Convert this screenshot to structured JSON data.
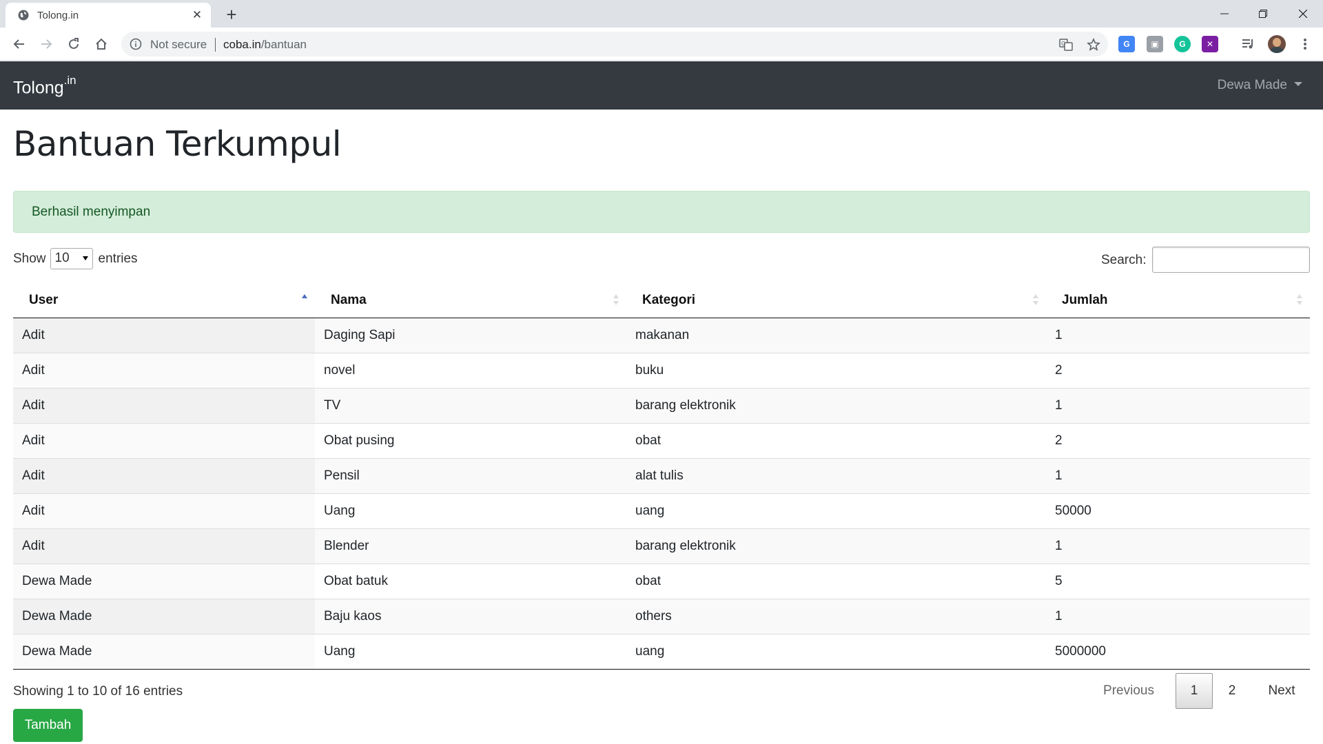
{
  "browser": {
    "tab_title": "Tolong.in",
    "address_security": "Not secure",
    "address_host": "coba.in",
    "address_path": "/bantuan"
  },
  "navbar": {
    "brand": "Tolong",
    "brand_sup": ".in",
    "user_name": "Dewa Made"
  },
  "page": {
    "title": "Bantuan Terkumpul",
    "alert": "Berhasil menyimpan"
  },
  "datatable": {
    "show_label": "Show",
    "entries_label": "entries",
    "page_length": "10",
    "search_label": "Search:",
    "search_value": "",
    "columns": [
      "User",
      "Nama",
      "Kategori",
      "Jumlah"
    ],
    "sorted_column": "User",
    "sort_direction": "ascending",
    "rows": [
      [
        "Adit",
        "Daging Sapi",
        "makanan",
        "1"
      ],
      [
        "Adit",
        "novel",
        "buku",
        "2"
      ],
      [
        "Adit",
        "TV",
        "barang elektronik",
        "1"
      ],
      [
        "Adit",
        "Obat pusing",
        "obat",
        "2"
      ],
      [
        "Adit",
        "Pensil",
        "alat tulis",
        "1"
      ],
      [
        "Adit",
        "Uang",
        "uang",
        "50000"
      ],
      [
        "Adit",
        "Blender",
        "barang elektronik",
        "1"
      ],
      [
        "Dewa Made",
        "Obat batuk",
        "obat",
        "5"
      ],
      [
        "Dewa Made",
        "Baju kaos",
        "others",
        "1"
      ],
      [
        "Dewa Made",
        "Uang",
        "uang",
        "5000000"
      ]
    ],
    "info": "Showing 1 to 10 of 16 entries",
    "pagination": {
      "previous": "Previous",
      "pages": [
        "1",
        "2"
      ],
      "current_page": "1",
      "next": "Next"
    }
  },
  "actions": {
    "add_label": "Tambah"
  },
  "colors": {
    "navbar_bg": "#343a40",
    "alert_bg": "#d4edda",
    "alert_text": "#155724",
    "button_success": "#28a745",
    "sort_active": "#4b6cc1"
  },
  "icons": {
    "tab_favicon": "globe-icon",
    "tab_close": "close-icon",
    "new_tab": "plus-icon",
    "back": "arrow-left-icon",
    "forward": "arrow-right-icon",
    "reload": "reload-icon",
    "home": "home-icon",
    "info": "info-icon",
    "translate": "translate-icon",
    "bookmark": "star-icon",
    "menu": "kebab-menu-icon"
  }
}
